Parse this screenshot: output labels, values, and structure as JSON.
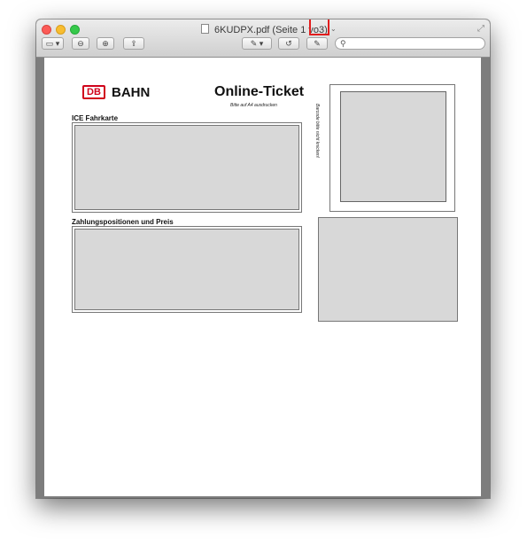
{
  "window": {
    "title_prefix": "6KUDPX.pdf (Seite 1 vo",
    "title_page_total": "3)",
    "title_chevron": "⌄"
  },
  "toolbar": {
    "sidebar_label": "▭ ▾",
    "zoom_out": "⊖",
    "zoom_in": "⊕",
    "share": "⇪",
    "markup": "✎ ▾",
    "rotate": "↺",
    "edit": "✎",
    "search_placeholder": ""
  },
  "document": {
    "logo_mark": "DB",
    "logo_text": "BAHN",
    "ticket_title": "Online-Ticket",
    "ticket_subtitle": "Bitte auf A4 ausdrucken",
    "section_fahrkarte": "ICE Fahrkarte",
    "section_zahlung": "Zahlungspositionen und Preis",
    "barcode_note": "Barcode bitte nicht knicken!"
  }
}
